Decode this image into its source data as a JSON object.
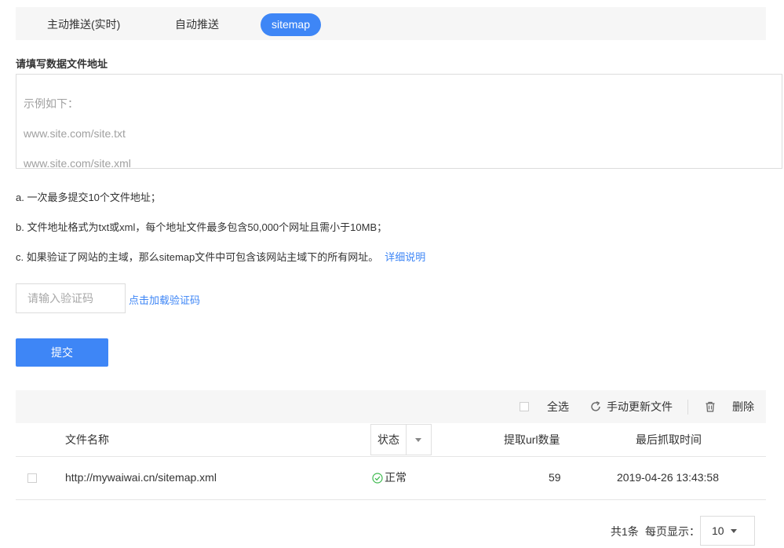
{
  "tabs": [
    {
      "label": "主动推送(实时)"
    },
    {
      "label": "自动推送"
    },
    {
      "label": "sitemap"
    }
  ],
  "form": {
    "field_label": "请填写数据文件地址",
    "placeholder_lines": [
      "示例如下：",
      "www.site.com/site.txt",
      "www.site.com/site.xml"
    ],
    "notes": {
      "a": "a. 一次最多提交10个文件地址；",
      "b": "b. 文件地址格式为txt或xml，每个地址文件最多包含50,000个网址且需小于10MB；",
      "c": "c. 如果验证了网站的主域，那么sitemap文件中可包含该网站主域下的所有网址。",
      "c_link": "详细说明"
    },
    "captcha_placeholder": "请输入验证码",
    "captcha_link": "点击加载验证码",
    "submit_label": "提交"
  },
  "toolbar": {
    "select_all": "全选",
    "refresh": "手动更新文件",
    "delete": "删除"
  },
  "table": {
    "columns": {
      "file_name": "文件名称",
      "status": "状态",
      "url_count": "提取url数量",
      "last_fetch": "最后抓取时间"
    },
    "rows": [
      {
        "file_name": "http://mywaiwai.cn/sitemap.xml",
        "status": "正常",
        "url_count": "59",
        "last_fetch": "2019-04-26 13:43:58"
      }
    ]
  },
  "pagination": {
    "total": "共1条",
    "per_page_label": "每页显示：",
    "per_page_value": "10"
  },
  "colors": {
    "accent": "#3e86f6",
    "status_ok": "#3fba50",
    "toolbar_bg": "#f6f6f6"
  },
  "icons": {
    "refresh": "refresh-icon",
    "delete": "trash-icon",
    "status_ok": "check-circle-icon",
    "dropdown": "caret-down-icon"
  }
}
